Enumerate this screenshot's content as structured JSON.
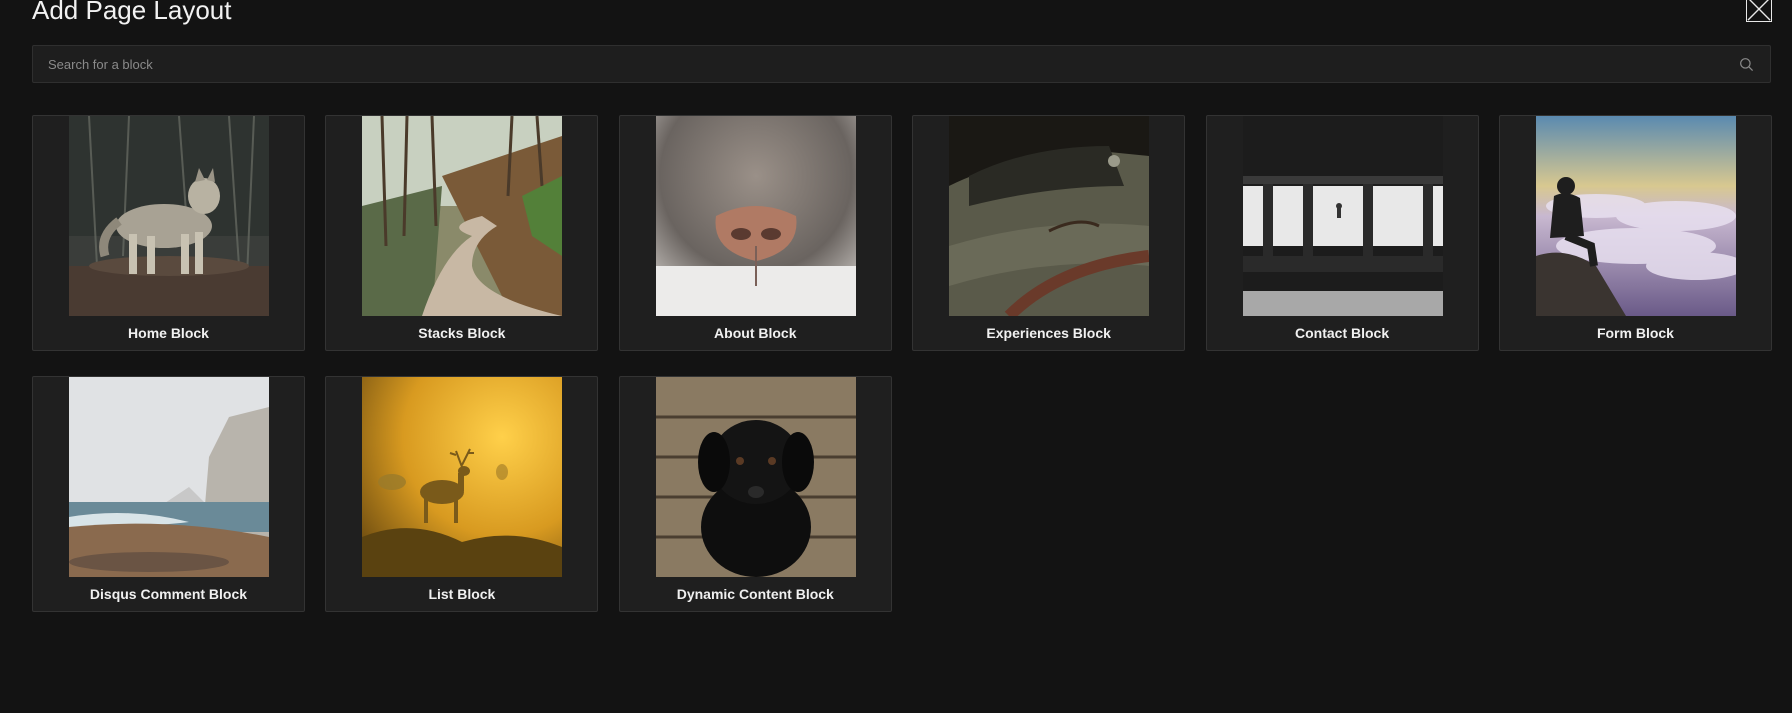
{
  "modal": {
    "title": "Add Page Layout"
  },
  "search": {
    "placeholder": "Search for a block"
  },
  "blocks": [
    {
      "label": "Home Block",
      "image": "wolf-in-forest"
    },
    {
      "label": "Stacks Block",
      "image": "forest-dirt-road"
    },
    {
      "label": "About Block",
      "image": "animal-nose-closeup"
    },
    {
      "label": "Experiences Block",
      "image": "vintage-car"
    },
    {
      "label": "Contact Block",
      "image": "subway-platform"
    },
    {
      "label": "Form Block",
      "image": "man-above-clouds"
    },
    {
      "label": "Disqus Comment Block",
      "image": "foggy-coast-cliffs"
    },
    {
      "label": "List Block",
      "image": "deer-in-golden-fog"
    },
    {
      "label": "Dynamic Content Block",
      "image": "black-puppy"
    }
  ],
  "colors": {
    "background": "#131313",
    "card": "#1f1f1f",
    "card_border": "#333333",
    "text": "#f0f0f0"
  }
}
